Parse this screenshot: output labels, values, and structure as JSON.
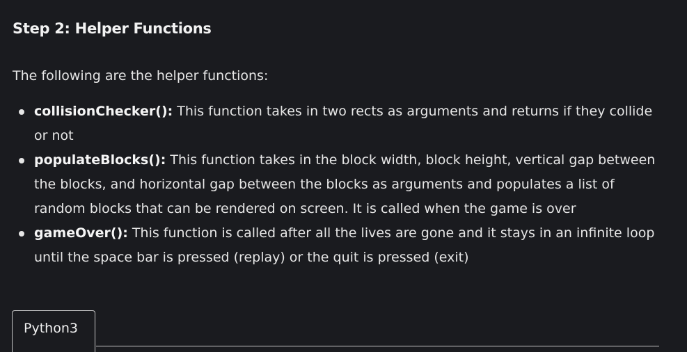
{
  "section": {
    "heading": "Step 2: Helper Functions",
    "intro": "The following are the helper functions:"
  },
  "functions": [
    {
      "name": "collisionChecker():",
      "description": " This function takes in two rects as arguments and returns if they collide or not"
    },
    {
      "name": "populateBlocks():",
      "description": " This function takes in the block width, block height, vertical gap between the blocks, and horizontal gap between the blocks as arguments and populates a list of random blocks that can be rendered on screen. It is called when the game is over"
    },
    {
      "name": "gameOver():",
      "description": " This function is called after all the lives are gone and it stays in an infinite loop until the space bar is pressed (replay) or the quit is pressed (exit)"
    }
  ],
  "code_tabs": [
    {
      "label": "Python3"
    }
  ]
}
